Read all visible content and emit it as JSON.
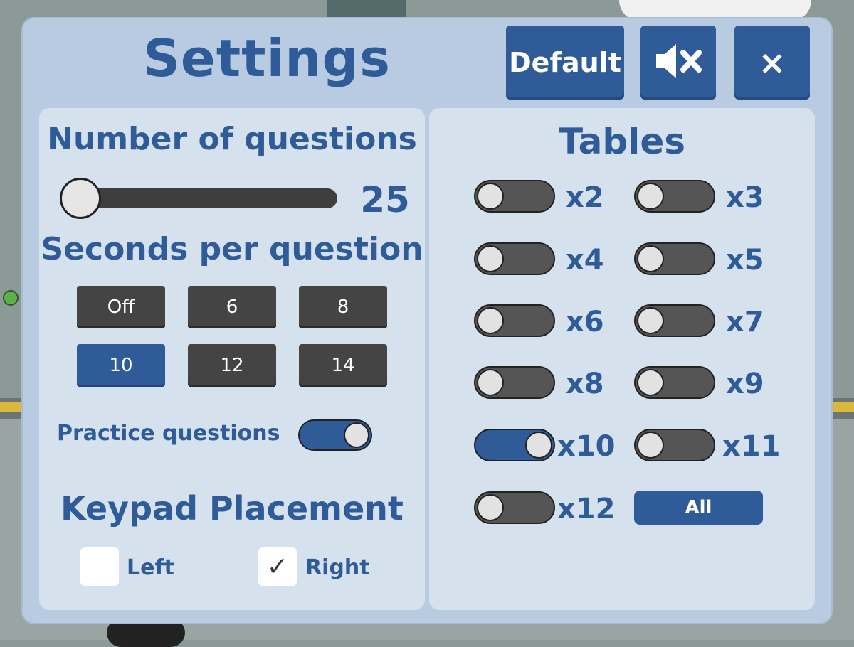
{
  "header": {
    "title": "Settings",
    "default_label": "Default",
    "sound_icon": "mute-icon",
    "close_icon": "close-icon",
    "close_label": "×"
  },
  "questions": {
    "heading": "Number of questions",
    "value": "25"
  },
  "seconds": {
    "heading": "Seconds per question",
    "options": [
      "Off",
      "6",
      "8",
      "10",
      "12",
      "14"
    ],
    "selected": "10"
  },
  "practice": {
    "label": "Practice questions",
    "enabled": true
  },
  "keypad": {
    "heading": "Keypad Placement",
    "left_label": "Left",
    "right_label": "Right",
    "left_checked": false,
    "right_checked": true,
    "check_glyph": "✓"
  },
  "tables": {
    "heading": "Tables",
    "items": [
      {
        "label": "x2",
        "on": false
      },
      {
        "label": "x3",
        "on": false
      },
      {
        "label": "x4",
        "on": false
      },
      {
        "label": "x5",
        "on": false
      },
      {
        "label": "x6",
        "on": false
      },
      {
        "label": "x7",
        "on": false
      },
      {
        "label": "x8",
        "on": false
      },
      {
        "label": "x9",
        "on": false
      },
      {
        "label": "x10",
        "on": true
      },
      {
        "label": "x11",
        "on": false
      },
      {
        "label": "x12",
        "on": false
      }
    ],
    "all_label": "All"
  },
  "colors": {
    "accent": "#2f5b99",
    "panel": "#b9cbe0",
    "card": "#d6e1ee",
    "inactive_button": "#444444"
  }
}
